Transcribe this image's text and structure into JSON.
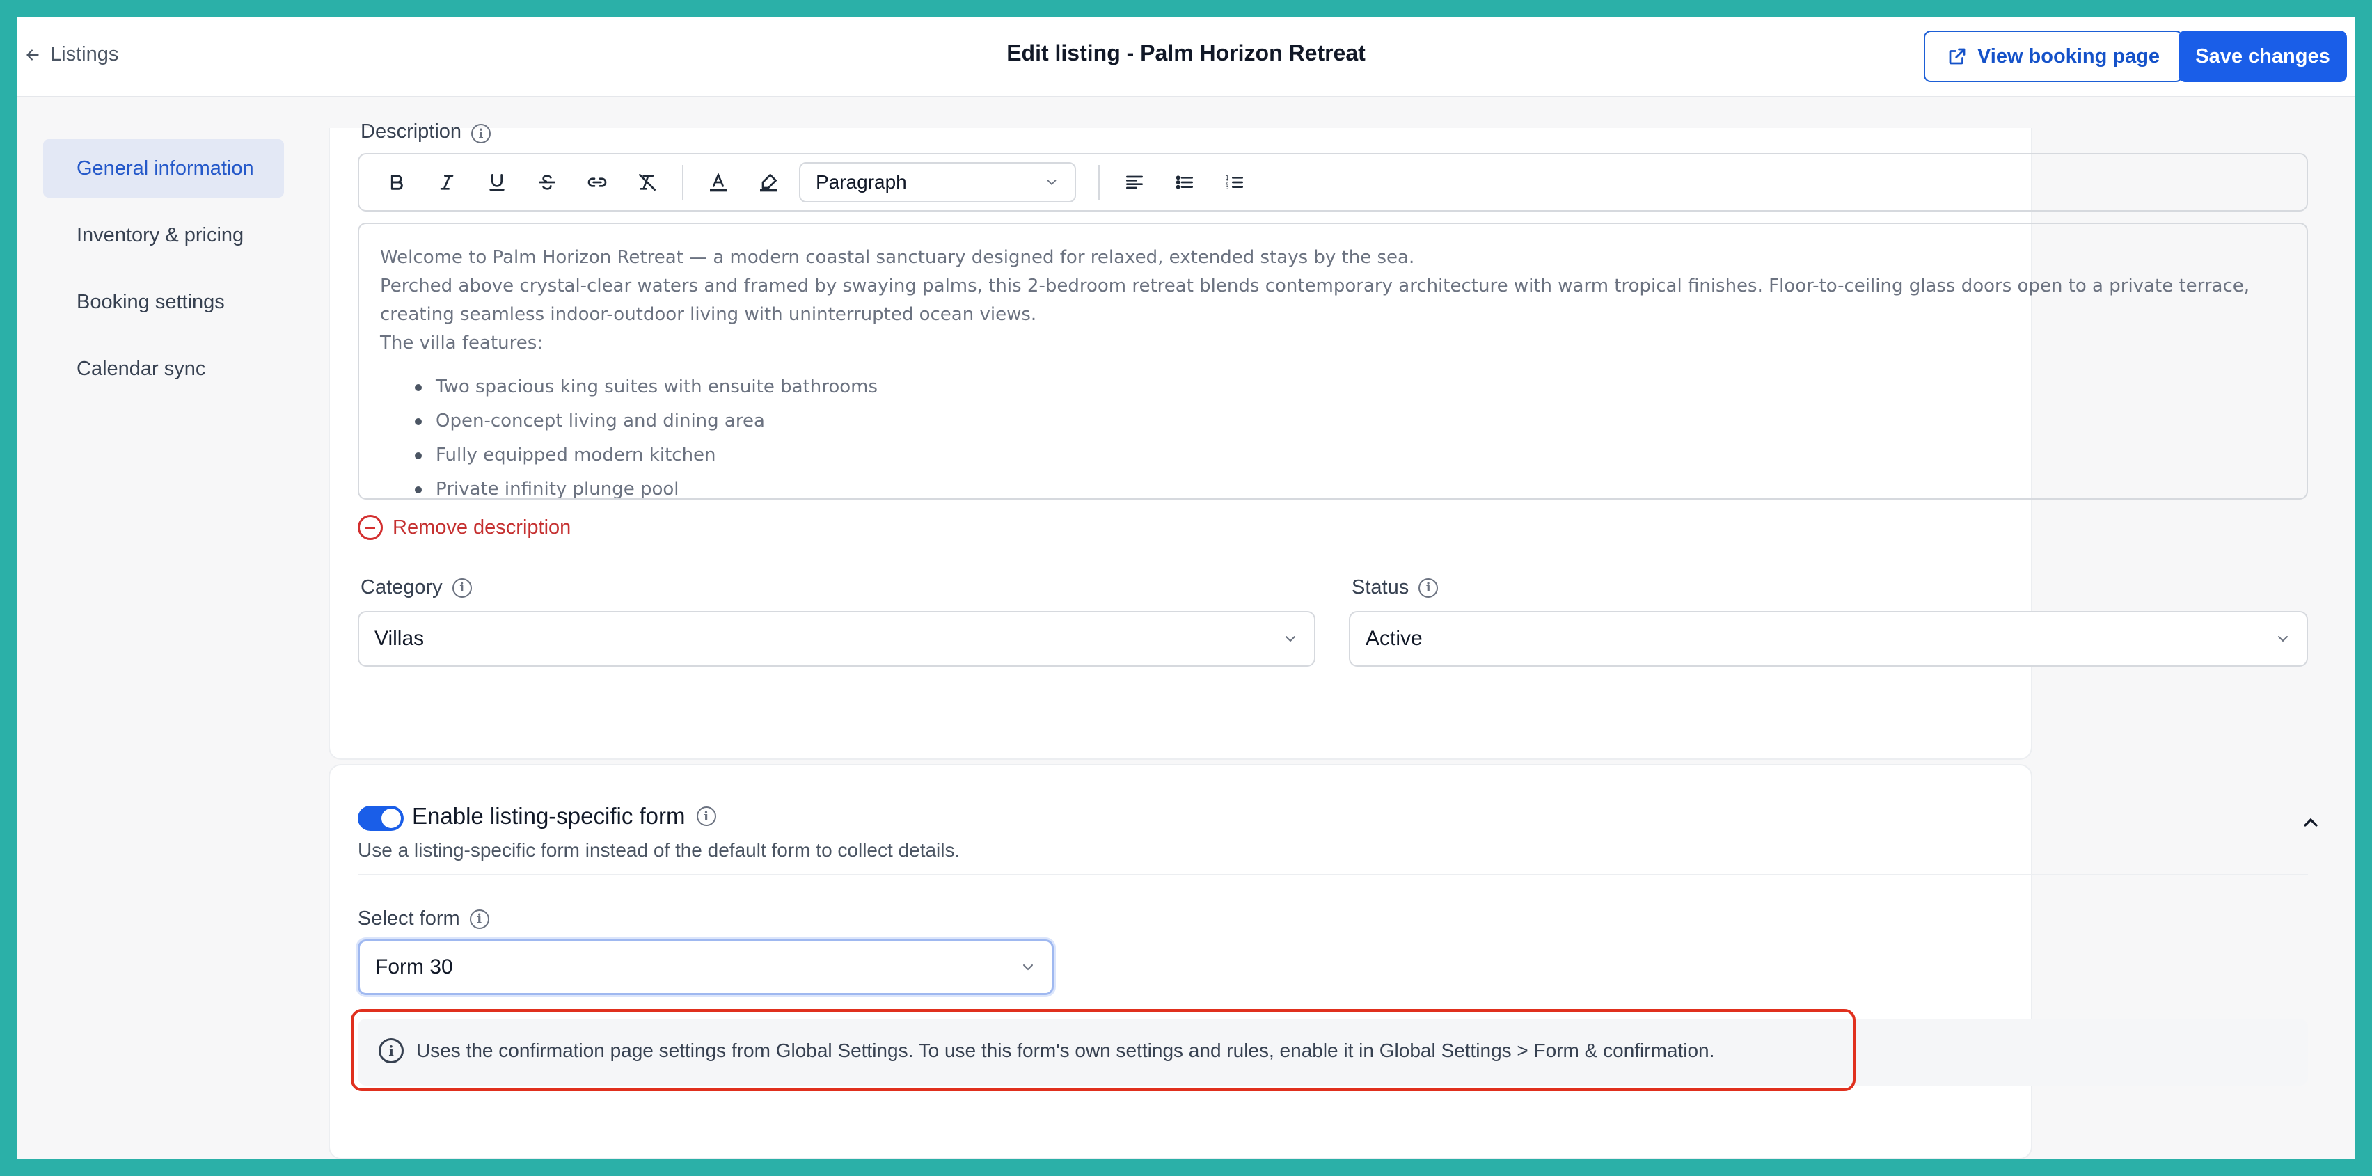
{
  "header": {
    "back_label": "Listings",
    "title": "Edit listing - Palm Horizon Retreat",
    "view_booking_label": "View booking page",
    "save_label": "Save changes"
  },
  "sidebar": {
    "items": [
      {
        "label": "General information",
        "active": true
      },
      {
        "label": "Inventory & pricing",
        "active": false
      },
      {
        "label": "Booking settings",
        "active": false
      },
      {
        "label": "Calendar sync",
        "active": false
      }
    ]
  },
  "description": {
    "label": "Description",
    "toolbar": {
      "icons": [
        "bold-icon",
        "italic-icon",
        "underline-icon",
        "strikethrough-icon",
        "link-icon",
        "clear-format-icon",
        "text-color-icon",
        "highlight-icon",
        "align-left-icon",
        "bullet-list-icon",
        "numbered-list-icon"
      ],
      "block_format": "Paragraph"
    },
    "content": {
      "p1": "Welcome to Palm Horizon Retreat — a modern coastal sanctuary designed for relaxed, extended stays by the sea.",
      "p2": "Perched above crystal-clear waters and framed by swaying palms, this 2-bedroom retreat blends contemporary architecture with warm tropical finishes. Floor-to-ceiling glass doors open to a private terrace, creating seamless indoor-outdoor living with uninterrupted ocean views.",
      "p3": "The villa features:",
      "bullets": [
        "Two spacious king suites with ensuite bathrooms",
        "Open-concept living and dining area",
        "Fully equipped modern kitchen",
        "Private infinity plunge pool"
      ]
    },
    "remove_label": "Remove description"
  },
  "category": {
    "label": "Category",
    "value": "Villas"
  },
  "status": {
    "label": "Status",
    "value": "Active"
  },
  "listing_form": {
    "enabled": true,
    "title": "Enable listing-specific form",
    "description": "Use a listing-specific form instead of the default form to collect details.",
    "select_label": "Select form",
    "selected_form": "Form 30",
    "notice": "Uses the confirmation page settings from Global Settings. To use this form's own settings and rules, enable it in Global Settings > Form & confirmation."
  },
  "colors": {
    "primary": "#1a5ee8",
    "accent_active_nav": "#e3e8f5",
    "danger": "#c53030",
    "highlight_border": "#e0301e",
    "background": "#2bb0a8"
  }
}
